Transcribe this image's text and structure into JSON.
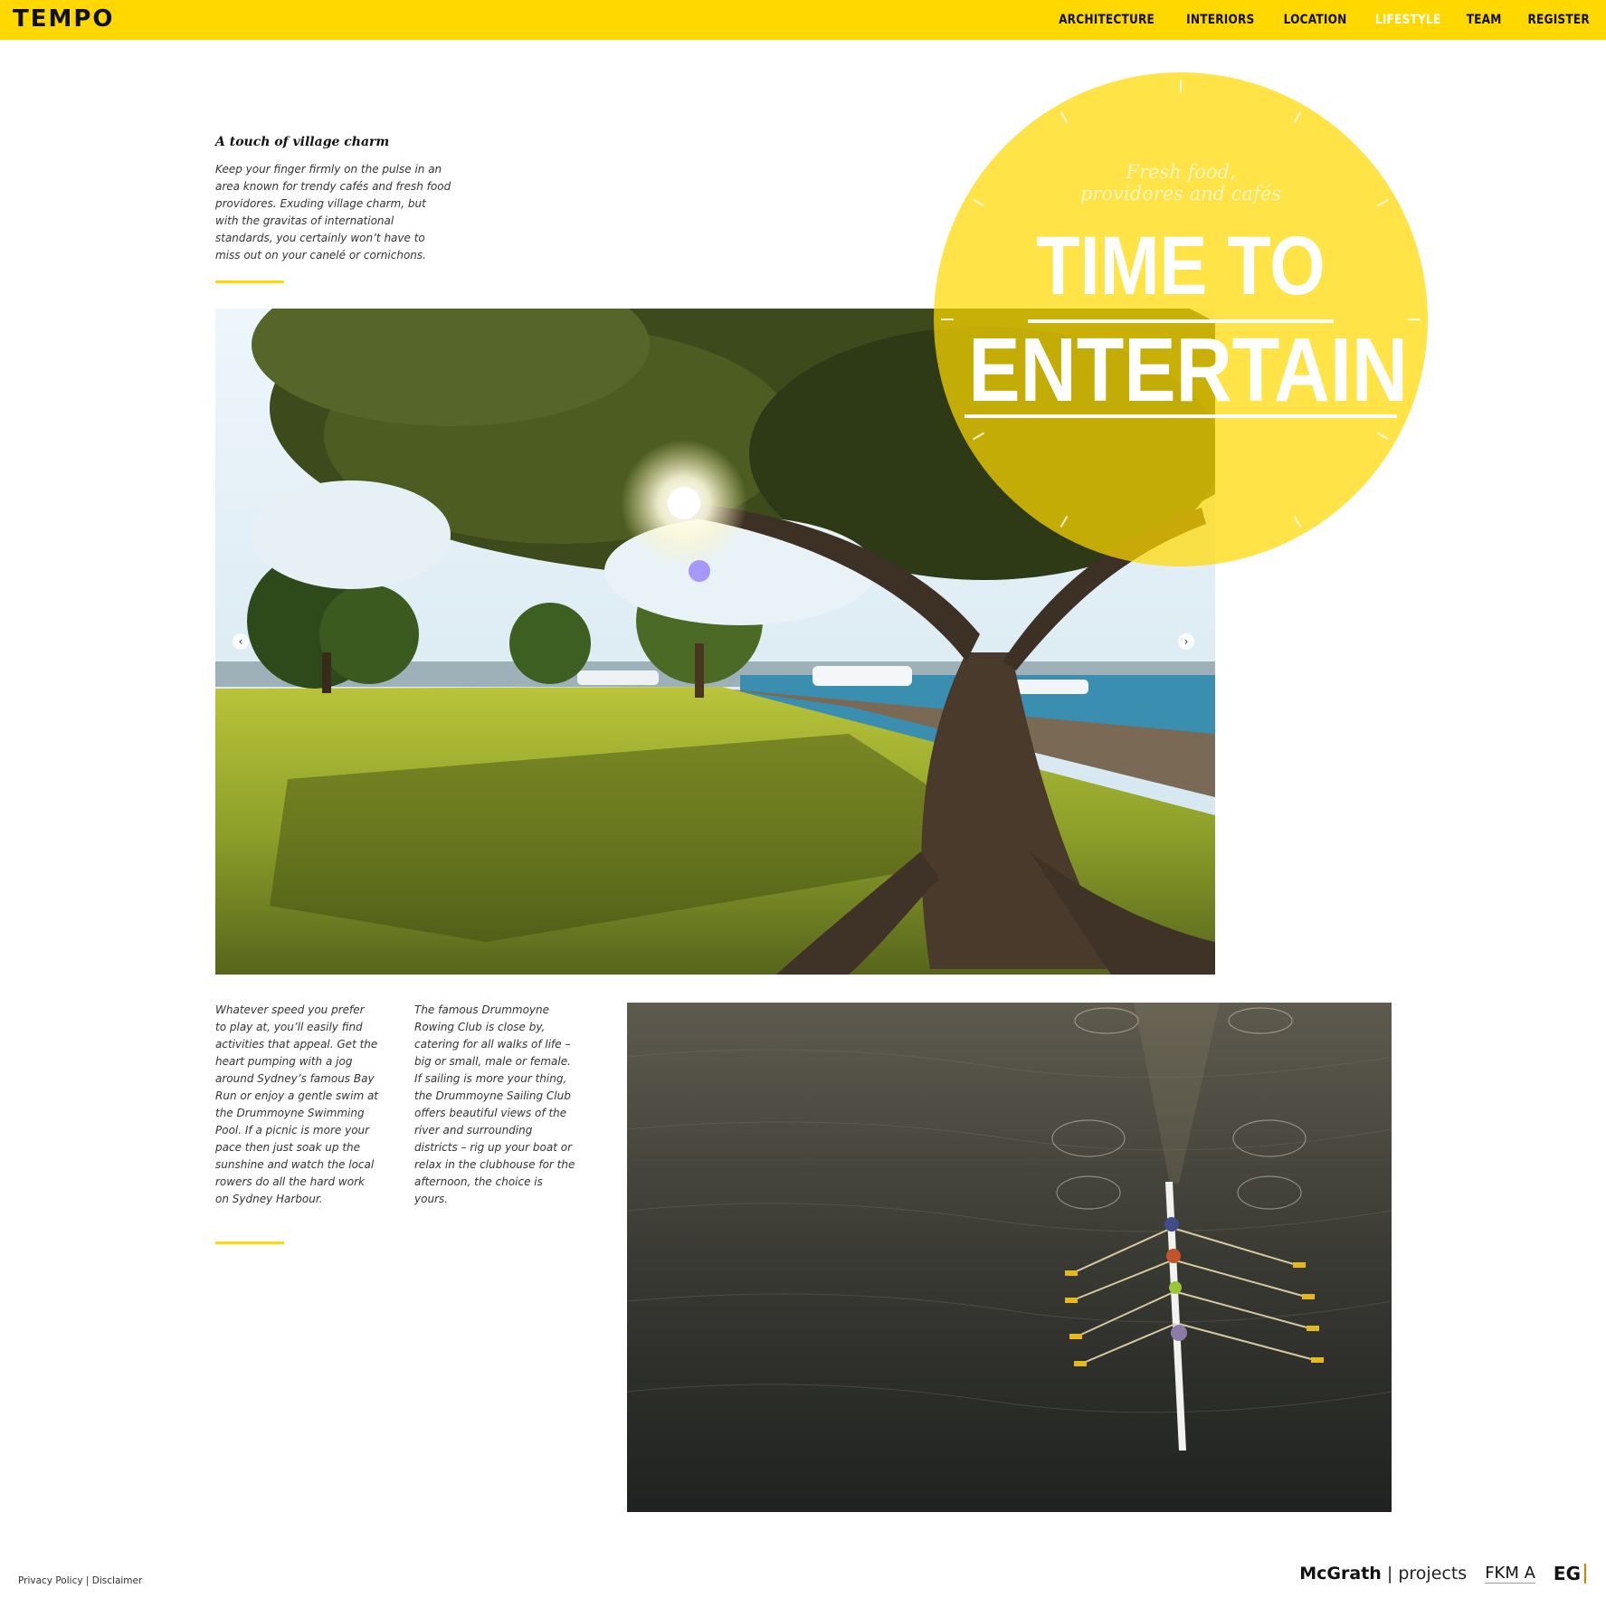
{
  "header": {
    "logo": "TEMPO",
    "nav": [
      {
        "label": "ARCHITECTURE",
        "active": false
      },
      {
        "label": "INTERIORS",
        "active": false
      },
      {
        "label": "LOCATION",
        "active": false
      },
      {
        "label": "LIFESTYLE",
        "active": true
      },
      {
        "label": "TEAM",
        "active": false
      },
      {
        "label": "REGISTER",
        "active": false
      }
    ]
  },
  "intro": {
    "title": "A touch of village charm",
    "body": "Keep your finger firmly on the pulse in an area known for trendy cafés and fresh food providores. Exuding village charm, but with the gravitas of international standards, you certainly won’t have to miss out on your canelé or cornichons."
  },
  "feature": {
    "tagline_line1": "Fresh food,",
    "tagline_line2": "providores and cafés",
    "headline_line1": "TIME TO",
    "headline_line2": "ENTERTAIN"
  },
  "slider": {
    "prev_icon": "chevron-left-icon",
    "next_icon": "chevron-right-icon",
    "prev_glyph": "‹",
    "next_glyph": "›"
  },
  "columns": {
    "left": "Whatever speed you prefer to play at, you’ll easily find activities that appeal. Get the heart pumping with a jog around Sydney’s famous Bay Run or enjoy a gentle swim at the Drummoyne Swimming Pool. If a picnic is more your pace then just soak up the sunshine and watch the local rowers do all the hard work on Sydney Harbour.",
    "right": "The famous Drummoyne Rowing Club is close by, catering for all walks of life – big or small, male or female. If sailing is more your thing, the Drummoyne Sailing Club offers beautiful views of the river and surrounding districts – rig up your boat or relax in the clubhouse for the afternoon, the choice is yours."
  },
  "footer": {
    "privacy": "Privacy Policy",
    "separator": "|",
    "disclaimer": "Disclaimer",
    "mcgrath_brand": "McGrath",
    "mcgrath_sep": "|",
    "mcgrath_suffix": "projects",
    "fkm": "FKM A",
    "eg": "EG"
  },
  "colors": {
    "brand_yellow": "#ffd800",
    "text_dark": "#111111"
  }
}
